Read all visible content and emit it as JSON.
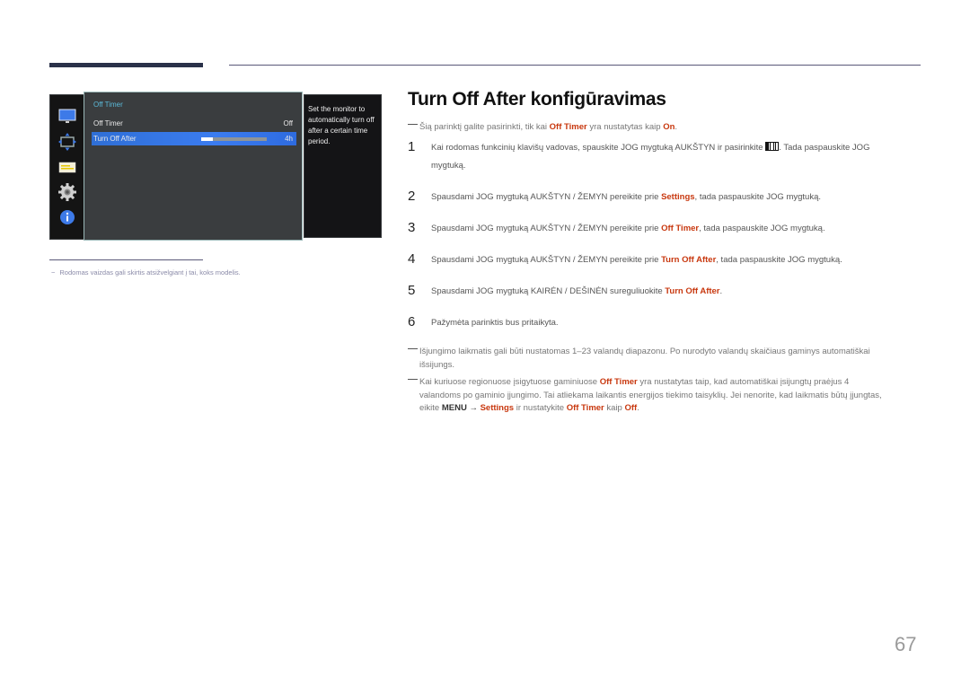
{
  "osd": {
    "title": "Off Timer",
    "rows": [
      {
        "label": "Off Timer",
        "value": "Off"
      },
      {
        "label": "Turn Off After",
        "value": "4h",
        "slider_fraction": 0.18
      }
    ],
    "description": "Set the monitor to automatically turn off after a certain time period.",
    "icons": [
      "monitor-icon",
      "position-icon",
      "picture-icon",
      "settings-gear-icon",
      "info-icon"
    ]
  },
  "footnote": {
    "dash": "−",
    "text": "Rodomas vaizdas gali skirtis atsižvelgiant į tai, koks modelis."
  },
  "heading": "Turn Off After konfigūravimas",
  "intro_note": {
    "pre": "Šią parinktį galite pasirinkti, tik kai ",
    "hl1": "Off Timer",
    "mid": " yra nustatytas kaip ",
    "hl2": "On",
    "post": "."
  },
  "steps": [
    {
      "num": "1",
      "pre": "Kai rodomas funkcinių klavišų vadovas, spauskite JOG mygtuką AUKŠTYN ir pasirinkite ",
      "post": ". Tada paspauskite JOG",
      "line2": "mygtuką."
    },
    {
      "num": "2",
      "pre": "Spausdami JOG mygtuką AUKŠTYN / ŽEMYN pereikite prie ",
      "hl": "Settings",
      "post": ", tada paspauskite JOG mygtuką."
    },
    {
      "num": "3",
      "pre": "Spausdami JOG mygtuką AUKŠTYN / ŽEMYN pereikite prie ",
      "hl": "Off Timer",
      "post": ", tada paspauskite JOG mygtuką."
    },
    {
      "num": "4",
      "pre": "Spausdami JOG mygtuką AUKŠTYN / ŽEMYN pereikite prie ",
      "hl": "Turn Off After",
      "post": ", tada paspauskite JOG mygtuką."
    },
    {
      "num": "5",
      "pre": "Spausdami JOG mygtuką KAIRĖN / DEŠINĖN sureguliuokite ",
      "hl": "Turn Off After",
      "post": "."
    },
    {
      "num": "6",
      "pre": "Pažymėta parinktis bus pritaikyta."
    }
  ],
  "note2": {
    "line1": "Išjungimo laikmatis gali būti nustatomas 1–23 valandų diapazonu. Po nurodyto valandų skaičiaus gaminys automatiškai",
    "line2": "išsijungs."
  },
  "note3": {
    "p1": "Kai kuriuose regionuose įsigytuose gaminiuose ",
    "hl1": "Off Timer",
    "p2": " yra nustatytas taip, kad automatiškai įsijungtų praėjus 4",
    "line2": "valandoms po gaminio įjungimo. Tai atliekama laikantis energijos tiekimo taisyklių. Jei nenorite, kad laikmatis būtų įjungtas,",
    "p3": "eikite ",
    "menu": "MENU",
    "arrow": " → ",
    "hl2": "Settings",
    "p4": " ir nustatykite ",
    "hl3": "Off Timer",
    "p5": " kaip ",
    "hl4": "Off",
    "p6": "."
  },
  "page_number": "67",
  "colors": {
    "accent": "#c8380f",
    "osd_selected": "#3b7cf0",
    "osd_title": "#5bb9d8",
    "header_bar": "#2a3149"
  }
}
